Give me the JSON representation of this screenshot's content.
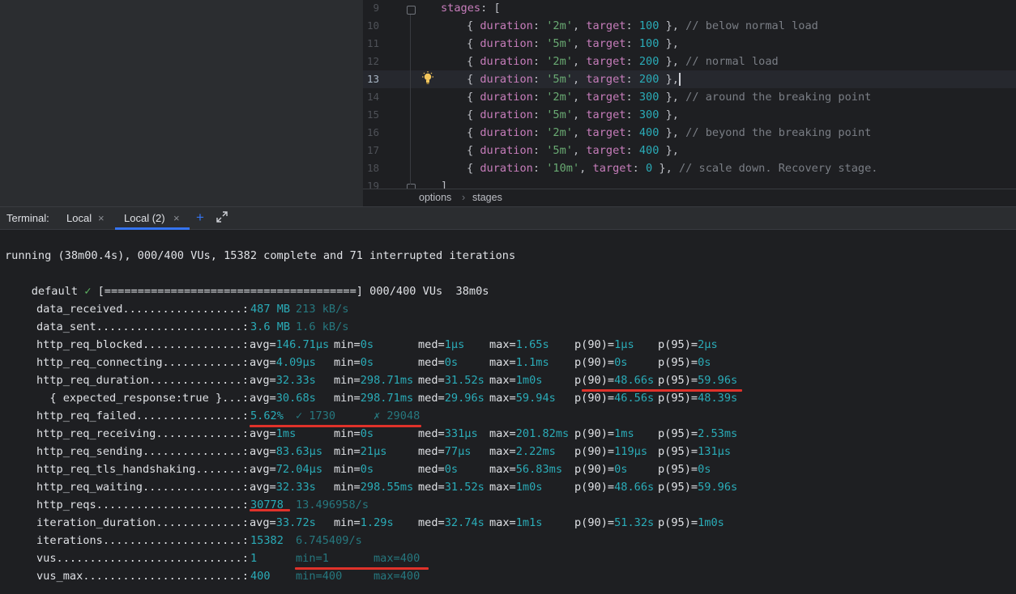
{
  "editor": {
    "lines": [
      {
        "n": "9",
        "segments": [
          [
            "prop",
            "stages"
          ],
          [
            "punct",
            ": ["
          ]
        ],
        "indent": 0
      },
      {
        "n": "10",
        "segments": [
          [
            "punct",
            "{ "
          ],
          [
            "prop",
            "duration"
          ],
          [
            "punct",
            ": "
          ],
          [
            "str",
            "'2m'"
          ],
          [
            "punct",
            ", "
          ],
          [
            "prop",
            "target"
          ],
          [
            "punct",
            ": "
          ],
          [
            "num",
            "100"
          ],
          [
            "punct",
            " }, "
          ],
          [
            "cmt",
            "// below normal load"
          ]
        ],
        "indent": 1
      },
      {
        "n": "11",
        "segments": [
          [
            "punct",
            "{ "
          ],
          [
            "prop",
            "duration"
          ],
          [
            "punct",
            ": "
          ],
          [
            "str",
            "'5m'"
          ],
          [
            "punct",
            ", "
          ],
          [
            "prop",
            "target"
          ],
          [
            "punct",
            ": "
          ],
          [
            "num",
            "100"
          ],
          [
            "punct",
            " },"
          ]
        ],
        "indent": 1
      },
      {
        "n": "12",
        "segments": [
          [
            "punct",
            "{ "
          ],
          [
            "prop",
            "duration"
          ],
          [
            "punct",
            ": "
          ],
          [
            "str",
            "'2m'"
          ],
          [
            "punct",
            ", "
          ],
          [
            "prop",
            "target"
          ],
          [
            "punct",
            ": "
          ],
          [
            "num",
            "200"
          ],
          [
            "punct",
            " }, "
          ],
          [
            "cmt",
            "// normal load"
          ]
        ],
        "indent": 1
      },
      {
        "n": "13",
        "segments": [
          [
            "punct",
            "{ "
          ],
          [
            "prop",
            "duration"
          ],
          [
            "punct",
            ": "
          ],
          [
            "str",
            "'5m'"
          ],
          [
            "punct",
            ", "
          ],
          [
            "prop",
            "target"
          ],
          [
            "punct",
            ": "
          ],
          [
            "num",
            "200"
          ],
          [
            "punct",
            " },"
          ]
        ],
        "indent": 1,
        "current": true
      },
      {
        "n": "14",
        "segments": [
          [
            "punct",
            "{ "
          ],
          [
            "prop",
            "duration"
          ],
          [
            "punct",
            ": "
          ],
          [
            "str",
            "'2m'"
          ],
          [
            "punct",
            ", "
          ],
          [
            "prop",
            "target"
          ],
          [
            "punct",
            ": "
          ],
          [
            "num",
            "300"
          ],
          [
            "punct",
            " }, "
          ],
          [
            "cmt",
            "// around the breaking point"
          ]
        ],
        "indent": 1
      },
      {
        "n": "15",
        "segments": [
          [
            "punct",
            "{ "
          ],
          [
            "prop",
            "duration"
          ],
          [
            "punct",
            ": "
          ],
          [
            "str",
            "'5m'"
          ],
          [
            "punct",
            ", "
          ],
          [
            "prop",
            "target"
          ],
          [
            "punct",
            ": "
          ],
          [
            "num",
            "300"
          ],
          [
            "punct",
            " },"
          ]
        ],
        "indent": 1
      },
      {
        "n": "16",
        "segments": [
          [
            "punct",
            "{ "
          ],
          [
            "prop",
            "duration"
          ],
          [
            "punct",
            ": "
          ],
          [
            "str",
            "'2m'"
          ],
          [
            "punct",
            ", "
          ],
          [
            "prop",
            "target"
          ],
          [
            "punct",
            ": "
          ],
          [
            "num",
            "400"
          ],
          [
            "punct",
            " }, "
          ],
          [
            "cmt",
            "// beyond the breaking point"
          ]
        ],
        "indent": 1
      },
      {
        "n": "17",
        "segments": [
          [
            "punct",
            "{ "
          ],
          [
            "prop",
            "duration"
          ],
          [
            "punct",
            ": "
          ],
          [
            "str",
            "'5m'"
          ],
          [
            "punct",
            ", "
          ],
          [
            "prop",
            "target"
          ],
          [
            "punct",
            ": "
          ],
          [
            "num",
            "400"
          ],
          [
            "punct",
            " },"
          ]
        ],
        "indent": 1
      },
      {
        "n": "18",
        "segments": [
          [
            "punct",
            "{ "
          ],
          [
            "prop",
            "duration"
          ],
          [
            "punct",
            ": "
          ],
          [
            "str",
            "'10m'"
          ],
          [
            "punct",
            ", "
          ],
          [
            "prop",
            "target"
          ],
          [
            "punct",
            ": "
          ],
          [
            "num",
            "0"
          ],
          [
            "punct",
            " }, "
          ],
          [
            "cmt",
            "// scale down. Recovery stage."
          ]
        ],
        "indent": 1
      },
      {
        "n": "19",
        "segments": [
          [
            "punct",
            "]"
          ]
        ],
        "indent": 0
      }
    ],
    "breadcrumb": [
      "options",
      "stages"
    ]
  },
  "terminal_tabs": {
    "label": "Terminal:",
    "tabs": [
      "Local",
      "Local (2)"
    ],
    "close_glyph": "×",
    "new_tab_glyph": "+"
  },
  "terminal": {
    "running_line": "running (38m00.4s), 000/400 VUs, 15382 complete and 71 interrupted iterations",
    "default_prefix": "default",
    "check_glyph": "✓",
    "progress_text": "[======================================] 000/400 VUs  38m0s",
    "metrics": [
      {
        "name": "data_received..................:",
        "v1": "487 MB",
        "v2": "213 kB/s"
      },
      {
        "name": "data_sent......................:",
        "v1": "3.6 MB",
        "v2": "1.6 kB/s"
      },
      {
        "name": "http_req_blocked...............:",
        "avg": "146.71µs",
        "min": "0s",
        "med": "1µs",
        "max": "1.65s",
        "p90": "1µs",
        "p95": "2µs"
      },
      {
        "name": "http_req_connecting............:",
        "avg": "4.09µs",
        "min": "0s",
        "med": "0s",
        "max": "1.1ms",
        "p90": "0s",
        "p95": "0s"
      },
      {
        "name": "http_req_duration..............:",
        "avg": "32.33s",
        "min": "298.71ms",
        "med": "31.52s",
        "max": "1m0s",
        "p90": "48.66s",
        "p95": "59.96s"
      },
      {
        "name": "  { expected_response:true }...:",
        "avg": "30.68s",
        "min": "298.71ms",
        "med": "29.96s",
        "max": "59.94s",
        "p90": "46.56s",
        "p95": "48.39s"
      },
      {
        "name": "http_req_failed................:",
        "v1": "5.62%",
        "v2": "✓ 1730",
        "v3": "✗ 29048"
      },
      {
        "name": "http_req_receiving.............:",
        "avg": "1ms",
        "min": "0s",
        "med": "331µs",
        "max": "201.82ms",
        "p90": "1ms",
        "p95": "2.53ms"
      },
      {
        "name": "http_req_sending...............:",
        "avg": "83.63µs",
        "min": "21µs",
        "med": "77µs",
        "max": "2.22ms",
        "p90": "119µs",
        "p95": "131µs"
      },
      {
        "name": "http_req_tls_handshaking.......:",
        "avg": "72.04µs",
        "min": "0s",
        "med": "0s",
        "max": "56.83ms",
        "p90": "0s",
        "p95": "0s"
      },
      {
        "name": "http_req_waiting...............:",
        "avg": "32.33s",
        "min": "298.55ms",
        "med": "31.52s",
        "max": "1m0s",
        "p90": "48.66s",
        "p95": "59.96s"
      },
      {
        "name": "http_reqs......................:",
        "v1": "30778",
        "v2": "13.496958/s"
      },
      {
        "name": "iteration_duration.............:",
        "avg": "33.72s",
        "min": "1.29s",
        "med": "32.74s",
        "max": "1m1s",
        "p90": "51.32s",
        "p95": "1m0s"
      },
      {
        "name": "iterations.....................:",
        "v1": "15382",
        "v2": "6.745409/s"
      },
      {
        "name": "vus............................:",
        "v1": "1",
        "v2": "min=1",
        "v3": "max=400"
      },
      {
        "name": "vus_max........................:",
        "v1": "400",
        "v2": "min=400",
        "v3": "max=400"
      }
    ]
  },
  "colors": {
    "accent": "#3574f0",
    "terminal_value": "#2aacb8",
    "terminal_dim": "#26787f",
    "annotation_red": "#e0322a"
  }
}
